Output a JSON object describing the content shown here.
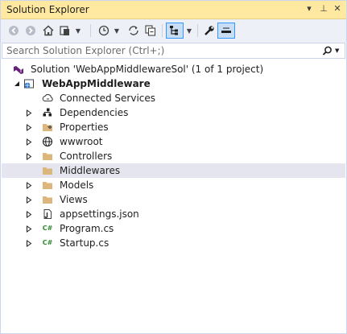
{
  "window": {
    "title": "Solution Explorer",
    "title_buttons": [
      "▾",
      "⊥",
      "✕"
    ]
  },
  "toolbar": {
    "buttons": [
      {
        "name": "back-icon"
      },
      {
        "name": "forward-icon"
      },
      {
        "name": "home-icon"
      },
      {
        "name": "switch-views-icon"
      },
      {
        "name": "pending-changes-filter-icon"
      },
      {
        "name": "sync-with-active-document-icon"
      },
      {
        "name": "collapse-all-icon"
      },
      {
        "name": "show-all-files-icon"
      },
      {
        "name": "properties-wrench-icon"
      },
      {
        "name": "preview-selected-items-icon"
      }
    ]
  },
  "search": {
    "placeholder": "Search Solution Explorer (Ctrl+;)",
    "value": ""
  },
  "tree": {
    "solution_label": "Solution 'WebAppMiddlewareSol' (1 of 1 project)",
    "project_label": "WebAppMiddleware",
    "items": [
      {
        "label": "Connected Services",
        "icon": "connected-services-icon",
        "expandable": false
      },
      {
        "label": "Dependencies",
        "icon": "dependencies-icon",
        "expandable": true
      },
      {
        "label": "Properties",
        "icon": "properties-folder-icon",
        "expandable": true
      },
      {
        "label": "wwwroot",
        "icon": "globe-icon",
        "expandable": true
      },
      {
        "label": "Controllers",
        "icon": "folder-icon",
        "expandable": true
      },
      {
        "label": "Middlewares",
        "icon": "folder-icon",
        "expandable": false,
        "selected": true
      },
      {
        "label": "Models",
        "icon": "folder-icon",
        "expandable": true
      },
      {
        "label": "Views",
        "icon": "folder-icon",
        "expandable": true
      },
      {
        "label": "appsettings.json",
        "icon": "json-file-icon",
        "expandable": true
      },
      {
        "label": "Program.cs",
        "icon": "csharp-file-icon",
        "expandable": true,
        "glyph": "C#"
      },
      {
        "label": "Startup.cs",
        "icon": "csharp-file-icon",
        "expandable": true,
        "glyph": "C#"
      }
    ]
  },
  "colors": {
    "title_bar": "#ffe9a0",
    "toolbar": "#eef0f8",
    "selected_row": "#e5e5ef",
    "folder": "#dcb67a",
    "vs_purple": "#68217a",
    "csharp_green": "#2e8b2e"
  }
}
